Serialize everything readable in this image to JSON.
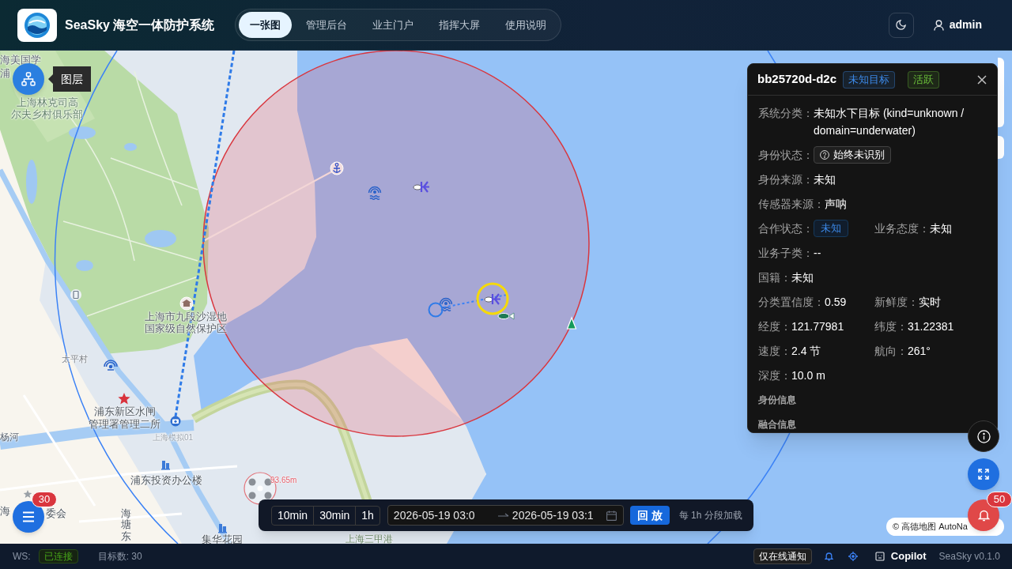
{
  "header": {
    "title": "SeaSky 海空一体防护系统",
    "nav": [
      {
        "label": "一张图",
        "selected": true
      },
      {
        "label": "管理后台",
        "selected": false
      },
      {
        "label": "业主门户",
        "selected": false
      },
      {
        "label": "指挥大屏",
        "selected": false
      },
      {
        "label": "使用说明",
        "selected": false
      }
    ],
    "user": "admin"
  },
  "map": {
    "layer_tooltip": "图层",
    "labels": [
      {
        "lines": [
          "海美国学"
        ]
      },
      {
        "lines": [
          "浦"
        ]
      },
      {
        "lines": [
          "上海林克司高",
          "尔夫乡村俱乐部"
        ]
      },
      {
        "lines": [
          "上海市九段沙湿地",
          "国家级自然保护区"
        ]
      },
      {
        "lines": [
          "太平村"
        ]
      },
      {
        "lines": [
          "浦东新区水闸",
          "管理署管理二所"
        ]
      },
      {
        "lines": [
          "上海模拟01"
        ]
      },
      {
        "lines": [
          "杨河"
        ]
      },
      {
        "lines": [
          "浦东投资办公楼"
        ]
      },
      {
        "lines": [
          "海"
        ]
      },
      {
        "lines": [
          "委会"
        ]
      },
      {
        "lines": [
          "海塘东"
        ]
      },
      {
        "lines": [
          "集华花园"
        ]
      },
      {
        "lines": [
          "上海三甲港"
        ]
      }
    ],
    "distance_label": "93.65m",
    "attribution": "© 高德地图 AutoNa",
    "menu_badge": "30",
    "alert_badge": "50"
  },
  "detail": {
    "id": "bb25720d-d2c",
    "tags": [
      {
        "text": "未知目标",
        "color": "#3c89e8"
      },
      {
        "text": "活跃",
        "color": "#6abe39"
      }
    ],
    "rows": [
      {
        "fields": [
          {
            "label": "系统分类：",
            "value": "未知水下目标 (kind=unknown / domain=underwater)",
            "kind": "text"
          }
        ]
      },
      {
        "fields": [
          {
            "label": "身份状态：",
            "value": "始终未识别",
            "kind": "status"
          }
        ]
      },
      {
        "fields": [
          {
            "label": "身份来源：",
            "value": "未知",
            "kind": "text"
          }
        ]
      },
      {
        "fields": [
          {
            "label": "传感器来源：",
            "value": "声呐",
            "kind": "text"
          }
        ]
      },
      {
        "fields": [
          {
            "label": "合作状态：",
            "value": "未知",
            "kind": "badge"
          },
          {
            "label": "业务态度：",
            "value": "未知",
            "kind": "text"
          }
        ]
      },
      {
        "fields": [
          {
            "label": "业务子类：",
            "value": "--",
            "kind": "text"
          }
        ]
      },
      {
        "fields": [
          {
            "label": "国籍：",
            "value": "未知",
            "kind": "text"
          }
        ]
      },
      {
        "fields": [
          {
            "label": "分类置信度：",
            "value": "0.59",
            "kind": "text"
          },
          {
            "label": "新鲜度：",
            "value": "实时",
            "kind": "text"
          }
        ]
      },
      {
        "fields": [
          {
            "label": "经度：",
            "value": "121.77981",
            "kind": "text"
          },
          {
            "label": "纬度：",
            "value": "31.22381",
            "kind": "text"
          }
        ]
      },
      {
        "fields": [
          {
            "label": "速度：",
            "value": "2.4 节",
            "kind": "text"
          },
          {
            "label": "航向：",
            "value": "261°",
            "kind": "text"
          }
        ]
      },
      {
        "fields": [
          {
            "label": "深度：",
            "value": "10.0 m",
            "kind": "text"
          }
        ]
      }
    ],
    "sections": [
      "身份信息",
      "融合信息"
    ]
  },
  "timeline": {
    "ranges": [
      "10min",
      "30min",
      "1h"
    ],
    "start": "2026-05-19 03:0",
    "end": "2026-05-19 03:1",
    "play": "回 放",
    "note": "每 1h 分段加载"
  },
  "status_bar": {
    "ws_label": "WS:",
    "ws_status": "已连接",
    "target_count": "目标数: 30",
    "notify": "仅在线通知",
    "copilot": "Copilot",
    "version": "SeaSky v0.1.0"
  }
}
